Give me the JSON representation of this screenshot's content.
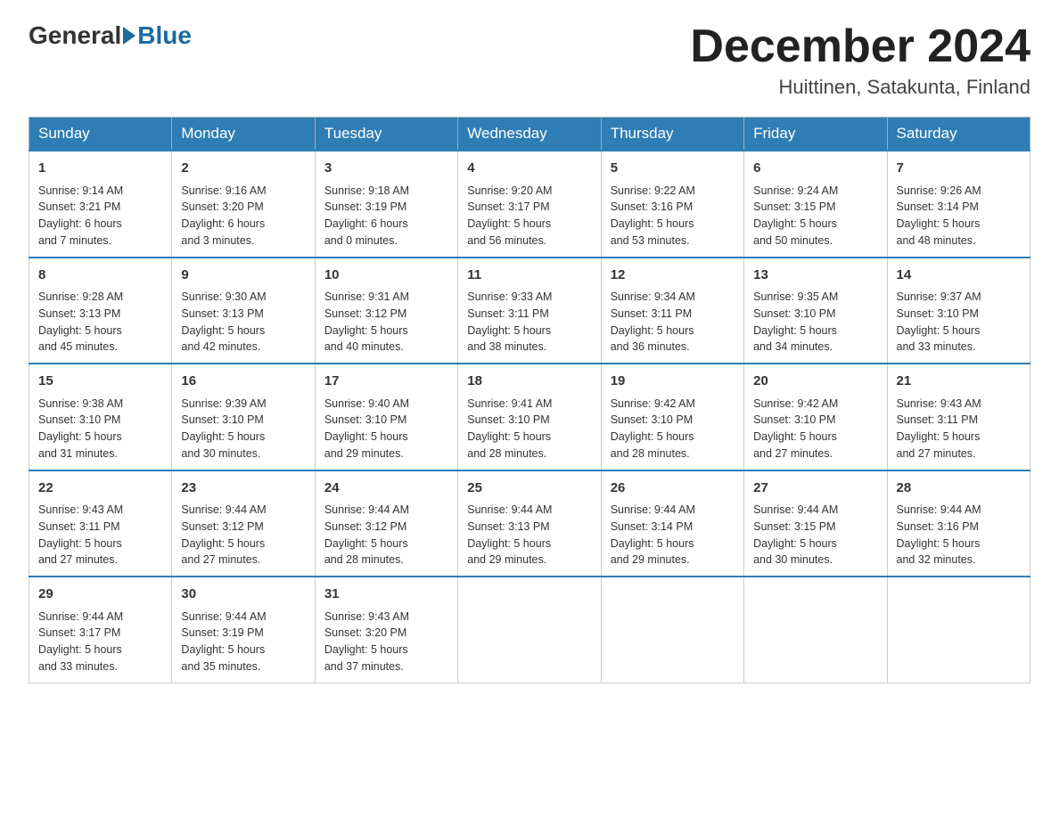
{
  "header": {
    "logo_general": "General",
    "logo_blue": "Blue",
    "title": "December 2024",
    "subtitle": "Huittinen, Satakunta, Finland"
  },
  "weekdays": [
    "Sunday",
    "Monday",
    "Tuesday",
    "Wednesday",
    "Thursday",
    "Friday",
    "Saturday"
  ],
  "weeks": [
    [
      {
        "day": "1",
        "info": "Sunrise: 9:14 AM\nSunset: 3:21 PM\nDaylight: 6 hours\nand 7 minutes."
      },
      {
        "day": "2",
        "info": "Sunrise: 9:16 AM\nSunset: 3:20 PM\nDaylight: 6 hours\nand 3 minutes."
      },
      {
        "day": "3",
        "info": "Sunrise: 9:18 AM\nSunset: 3:19 PM\nDaylight: 6 hours\nand 0 minutes."
      },
      {
        "day": "4",
        "info": "Sunrise: 9:20 AM\nSunset: 3:17 PM\nDaylight: 5 hours\nand 56 minutes."
      },
      {
        "day": "5",
        "info": "Sunrise: 9:22 AM\nSunset: 3:16 PM\nDaylight: 5 hours\nand 53 minutes."
      },
      {
        "day": "6",
        "info": "Sunrise: 9:24 AM\nSunset: 3:15 PM\nDaylight: 5 hours\nand 50 minutes."
      },
      {
        "day": "7",
        "info": "Sunrise: 9:26 AM\nSunset: 3:14 PM\nDaylight: 5 hours\nand 48 minutes."
      }
    ],
    [
      {
        "day": "8",
        "info": "Sunrise: 9:28 AM\nSunset: 3:13 PM\nDaylight: 5 hours\nand 45 minutes."
      },
      {
        "day": "9",
        "info": "Sunrise: 9:30 AM\nSunset: 3:13 PM\nDaylight: 5 hours\nand 42 minutes."
      },
      {
        "day": "10",
        "info": "Sunrise: 9:31 AM\nSunset: 3:12 PM\nDaylight: 5 hours\nand 40 minutes."
      },
      {
        "day": "11",
        "info": "Sunrise: 9:33 AM\nSunset: 3:11 PM\nDaylight: 5 hours\nand 38 minutes."
      },
      {
        "day": "12",
        "info": "Sunrise: 9:34 AM\nSunset: 3:11 PM\nDaylight: 5 hours\nand 36 minutes."
      },
      {
        "day": "13",
        "info": "Sunrise: 9:35 AM\nSunset: 3:10 PM\nDaylight: 5 hours\nand 34 minutes."
      },
      {
        "day": "14",
        "info": "Sunrise: 9:37 AM\nSunset: 3:10 PM\nDaylight: 5 hours\nand 33 minutes."
      }
    ],
    [
      {
        "day": "15",
        "info": "Sunrise: 9:38 AM\nSunset: 3:10 PM\nDaylight: 5 hours\nand 31 minutes."
      },
      {
        "day": "16",
        "info": "Sunrise: 9:39 AM\nSunset: 3:10 PM\nDaylight: 5 hours\nand 30 minutes."
      },
      {
        "day": "17",
        "info": "Sunrise: 9:40 AM\nSunset: 3:10 PM\nDaylight: 5 hours\nand 29 minutes."
      },
      {
        "day": "18",
        "info": "Sunrise: 9:41 AM\nSunset: 3:10 PM\nDaylight: 5 hours\nand 28 minutes."
      },
      {
        "day": "19",
        "info": "Sunrise: 9:42 AM\nSunset: 3:10 PM\nDaylight: 5 hours\nand 28 minutes."
      },
      {
        "day": "20",
        "info": "Sunrise: 9:42 AM\nSunset: 3:10 PM\nDaylight: 5 hours\nand 27 minutes."
      },
      {
        "day": "21",
        "info": "Sunrise: 9:43 AM\nSunset: 3:11 PM\nDaylight: 5 hours\nand 27 minutes."
      }
    ],
    [
      {
        "day": "22",
        "info": "Sunrise: 9:43 AM\nSunset: 3:11 PM\nDaylight: 5 hours\nand 27 minutes."
      },
      {
        "day": "23",
        "info": "Sunrise: 9:44 AM\nSunset: 3:12 PM\nDaylight: 5 hours\nand 27 minutes."
      },
      {
        "day": "24",
        "info": "Sunrise: 9:44 AM\nSunset: 3:12 PM\nDaylight: 5 hours\nand 28 minutes."
      },
      {
        "day": "25",
        "info": "Sunrise: 9:44 AM\nSunset: 3:13 PM\nDaylight: 5 hours\nand 29 minutes."
      },
      {
        "day": "26",
        "info": "Sunrise: 9:44 AM\nSunset: 3:14 PM\nDaylight: 5 hours\nand 29 minutes."
      },
      {
        "day": "27",
        "info": "Sunrise: 9:44 AM\nSunset: 3:15 PM\nDaylight: 5 hours\nand 30 minutes."
      },
      {
        "day": "28",
        "info": "Sunrise: 9:44 AM\nSunset: 3:16 PM\nDaylight: 5 hours\nand 32 minutes."
      }
    ],
    [
      {
        "day": "29",
        "info": "Sunrise: 9:44 AM\nSunset: 3:17 PM\nDaylight: 5 hours\nand 33 minutes."
      },
      {
        "day": "30",
        "info": "Sunrise: 9:44 AM\nSunset: 3:19 PM\nDaylight: 5 hours\nand 35 minutes."
      },
      {
        "day": "31",
        "info": "Sunrise: 9:43 AM\nSunset: 3:20 PM\nDaylight: 5 hours\nand 37 minutes."
      },
      {
        "day": "",
        "info": ""
      },
      {
        "day": "",
        "info": ""
      },
      {
        "day": "",
        "info": ""
      },
      {
        "day": "",
        "info": ""
      }
    ]
  ]
}
